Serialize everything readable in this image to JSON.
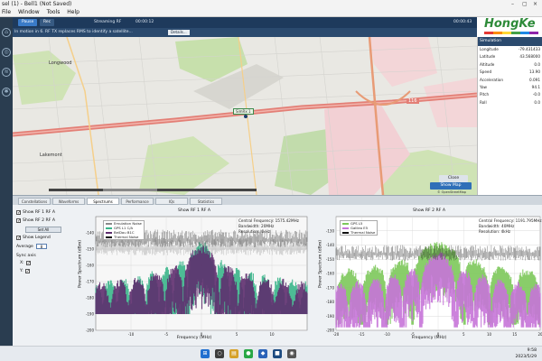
{
  "window": {
    "title": "sel (1) - Bell1 (Not Saved)"
  },
  "menu": [
    "File",
    "Window",
    "Tools",
    "Help"
  ],
  "toolbar": {
    "start_label": "Pause",
    "rec_label": "Rec",
    "mode_text": "Streaming RF",
    "time_text": "00:00:12",
    "right_text": "00:00:43"
  },
  "infobar": {
    "message": "In motion in 6. RF TX replaces RMS to identify a satellite...",
    "details_label": "Details..."
  },
  "logo": {
    "text": "HongKe",
    "colors": [
      "#e53935",
      "#fb8c00",
      "#fdd835",
      "#43a047",
      "#1e88e5",
      "#8e24aa"
    ]
  },
  "map": {
    "labels": {
      "city": "Longwood",
      "left_area": "Lakemont",
      "highway": "116",
      "vehicle": "SimRx 1"
    },
    "buttons": {
      "center": "Close",
      "follow": "Show Map"
    },
    "attribution": "© OpenStreetMap"
  },
  "simulation": {
    "title": "Simulation",
    "rows": [
      {
        "k": "Longitude",
        "v": "-79.431433"
      },
      {
        "k": "Latitude",
        "v": "43.568000"
      },
      {
        "k": "Altitude",
        "v": "0.0"
      },
      {
        "k": "Speed",
        "v": "13.90"
      },
      {
        "k": "Acceleration",
        "v": "0.091"
      },
      {
        "k": "Yaw",
        "v": "94.1"
      },
      {
        "k": "Pitch",
        "v": "-0.0"
      },
      {
        "k": "Roll",
        "v": "0.0"
      }
    ]
  },
  "tabs": [
    {
      "label": "Constellations",
      "active": false
    },
    {
      "label": "Waveforms",
      "active": false
    },
    {
      "label": "Spectrums",
      "active": true
    },
    {
      "label": "Performance",
      "active": false
    },
    {
      "label": "IQs",
      "active": false
    },
    {
      "label": "Statistics",
      "active": false
    }
  ],
  "controls": {
    "items": [
      {
        "label": "Show RF 1 RF A",
        "checked": true
      },
      {
        "label": "Show RF 2 RF A",
        "checked": true
      },
      {
        "label": "Show Legend",
        "checked": true
      }
    ],
    "set_all_label": "Set All",
    "average_label": "Average",
    "average_value": "8",
    "sync_label": "Sync axis",
    "x_label": "X:",
    "y_label": "Y:",
    "x_checked": true,
    "y_checked": true
  },
  "chart_data": [
    {
      "type": "line",
      "title": "Show RF 1 RF A",
      "xlabel": "Frequency (MHz)",
      "ylabel": "Power Spectrum (dBm)",
      "xlim": [
        -15,
        15
      ],
      "ylim": [
        -200,
        -130
      ],
      "xticks": [
        -10,
        -5,
        0,
        5,
        10
      ],
      "yticks": [
        -140,
        -150,
        -160,
        -170,
        -180,
        -190,
        -200
      ],
      "stats": [
        "Central Frequency: 1575.42MHz",
        "Bandwidth: 20MHz",
        "Resolution: 4kHz"
      ],
      "legend": [
        {
          "name": "Emulation Noise",
          "color": "#8a8a8a"
        },
        {
          "name": "GPS L1 C/A",
          "color": "#3ab58a"
        },
        {
          "name": "BeiDou B1C",
          "color": "#5e2d6e"
        },
        {
          "name": "Thermal Noise",
          "color": "#111111"
        }
      ],
      "series": [
        {
          "name": "Emulation Noise",
          "color": "#8a8a8a",
          "level": -146
        },
        {
          "name": "GPS L1 C/A",
          "color": "#3ab58a",
          "peak": -147,
          "floor": -190,
          "lobe_width": 2.0
        },
        {
          "name": "BeiDou B1C",
          "color": "#5e2d6e",
          "peak": -150,
          "floor": -190,
          "lobe_width": 2.6
        },
        {
          "name": "Thermal Noise",
          "color": "#111111",
          "level": -141
        }
      ]
    },
    {
      "type": "line",
      "title": "Show RF 2 RF A",
      "xlabel": "Frequency (MHz)",
      "ylabel": "Power Spectrum (dBm)",
      "xlim": [
        -20,
        20
      ],
      "ylim": [
        -200,
        -120
      ],
      "xticks": [
        -20,
        -15,
        -10,
        -5,
        0,
        5,
        10,
        15,
        20
      ],
      "yticks": [
        -130,
        -140,
        -150,
        -160,
        -170,
        -180,
        -190,
        -200
      ],
      "stats": [
        "Central Frequency: 1191.795MHz",
        "Bandwidth: 40MHz",
        "Resolution: 4kHz"
      ],
      "legend": [
        {
          "name": "GPS L5",
          "color": "#7cc85a"
        },
        {
          "name": "Galileo E5",
          "color": "#c674d8"
        },
        {
          "name": "Thermal Noise",
          "color": "#111111"
        }
      ],
      "series": [
        {
          "name": "GPS L5",
          "color": "#7cc85a",
          "peak": -140,
          "floor": -196,
          "lobe_width": 5.0
        },
        {
          "name": "Galileo E5",
          "color": "#c674d8",
          "peak": -147,
          "floor": -198,
          "lobe_width": 3.5
        },
        {
          "name": "Thermal Noise",
          "color": "#111111",
          "level": -143
        }
      ]
    }
  ],
  "taskbar": {
    "icons": [
      {
        "name": "start-icon",
        "color": "#1f6fd0",
        "glyph": "⊞"
      },
      {
        "name": "search-icon",
        "color": "#3d3d3d",
        "glyph": "○"
      },
      {
        "name": "files-icon",
        "color": "#d6a22a",
        "glyph": "▤"
      },
      {
        "name": "chat-icon",
        "color": "#28a745",
        "glyph": "●"
      },
      {
        "name": "app-icon",
        "color": "#2a62b8",
        "glyph": "◆"
      },
      {
        "name": "bell1-icon",
        "color": "#1b4a80",
        "glyph": "■"
      },
      {
        "name": "camera-icon",
        "color": "#555555",
        "glyph": "◉"
      }
    ],
    "time": "9:58",
    "date": "2023/5/29"
  }
}
